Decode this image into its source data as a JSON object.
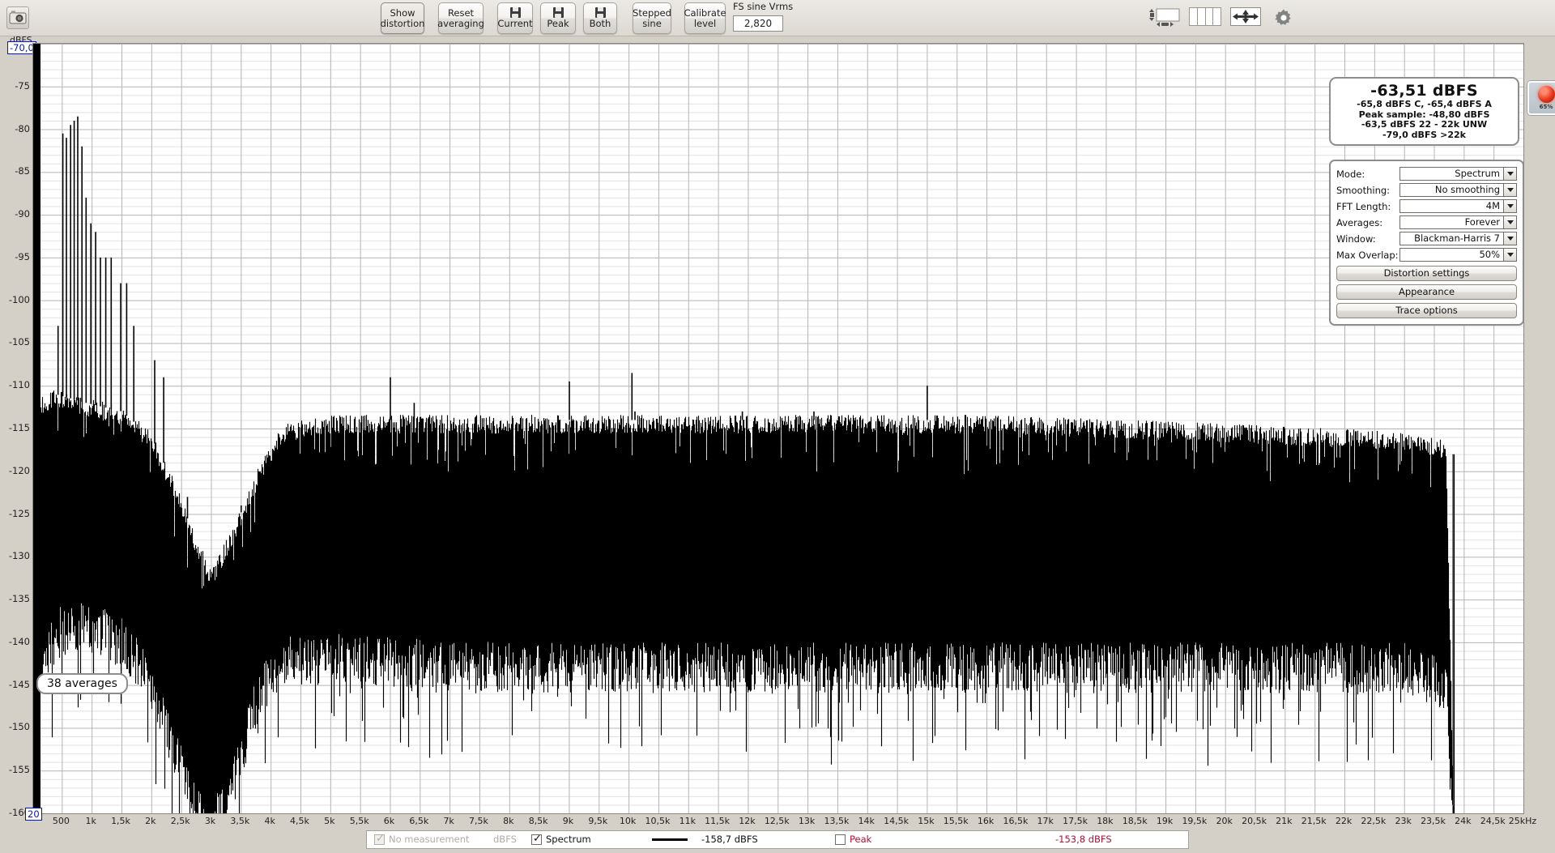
{
  "toolbar": {
    "camera_icon": "camera-icon",
    "buttons": [
      {
        "name": "show-distortion",
        "lines": [
          "Show",
          "distortion"
        ],
        "icon": null,
        "active": true,
        "x": 470,
        "w": 54
      },
      {
        "name": "reset-averaging",
        "lines": [
          "Reset",
          "averaging"
        ],
        "icon": null,
        "active": false,
        "x": 541,
        "w": 56
      },
      {
        "name": "save-current",
        "lines": [
          "Current"
        ],
        "icon": "floppy-icon",
        "active": false,
        "x": 614,
        "w": 44
      },
      {
        "name": "save-peak",
        "lines": [
          "Peak"
        ],
        "icon": "floppy-icon",
        "active": false,
        "x": 667,
        "w": 44
      },
      {
        "name": "save-both",
        "lines": [
          "Both"
        ],
        "icon": "floppy-icon",
        "active": false,
        "x": 720,
        "w": 42
      },
      {
        "name": "stepped-sine",
        "lines": [
          "Stepped",
          "sine"
        ],
        "icon": null,
        "active": false,
        "x": 781,
        "w": 48
      },
      {
        "name": "calibrate-level",
        "lines": [
          "Calibrate",
          "level"
        ],
        "icon": null,
        "active": false,
        "x": 845,
        "w": 51
      }
    ],
    "fs_sine": {
      "label": "FS sine Vrms",
      "value": "2,820"
    },
    "right_icons": [
      "scroll-box-icon",
      "columns-icon",
      "pan-arrows-icon",
      "gear-icon"
    ]
  },
  "chart_data": {
    "type": "line",
    "title": "",
    "xlabel": "",
    "ylabel": "dBFS",
    "xlim": [
      20,
      25000
    ],
    "ylim": [
      -160,
      -70
    ],
    "y_unit": "dBFS",
    "y_top_value": "-70,0",
    "x_start_value": "20",
    "x_end_label": "25kHz",
    "yticks": [
      -75,
      -80,
      -85,
      -90,
      -95,
      -100,
      -105,
      -110,
      -115,
      -120,
      -125,
      -130,
      -135,
      -140,
      -145,
      -150,
      -155,
      -160
    ],
    "ytick_labels": [
      "-75",
      "-80",
      "-85",
      "-90",
      "-95",
      "-100",
      "-105",
      "-110",
      "-115",
      "-120",
      "-125",
      "-130",
      "-135",
      "-140",
      "-145",
      "-150",
      "-155",
      "-160"
    ],
    "xticks": [
      500,
      1000,
      1500,
      2000,
      2500,
      3000,
      3500,
      4000,
      4500,
      5000,
      5500,
      6000,
      6500,
      7000,
      7500,
      8000,
      8500,
      9000,
      9500,
      10000,
      10500,
      11000,
      11500,
      12000,
      12500,
      13000,
      13500,
      14000,
      14500,
      15000,
      15500,
      16000,
      16500,
      17000,
      17500,
      18000,
      18500,
      19000,
      19500,
      20000,
      20500,
      21000,
      21500,
      22000,
      22500,
      23000,
      23500,
      24000,
      24500,
      25000
    ],
    "xtick_labels": [
      "500",
      "1k",
      "1,5k",
      "2k",
      "2,5k",
      "3k",
      "3,5k",
      "4k",
      "4,5k",
      "5k",
      "5,5k",
      "6k",
      "6,5k",
      "7k",
      "7,5k",
      "8k",
      "8,5k",
      "9k",
      "9,5k",
      "10k",
      "10,5k",
      "11k",
      "11,5k",
      "12k",
      "12,5k",
      "13k",
      "13,5k",
      "14k",
      "14,5k",
      "15k",
      "15,5k",
      "16k",
      "16,5k",
      "17k",
      "17,5k",
      "18k",
      "18,5k",
      "19k",
      "19,5k",
      "20k",
      "20,5k",
      "21k",
      "21,5k",
      "22k",
      "22,5k",
      "23k",
      "23,5k",
      "24k",
      "24,5k",
      "25kHz"
    ],
    "grid": true,
    "legend": "none",
    "trace_color": "#000000",
    "annotation": "38 averages",
    "series": [
      {
        "name": "Spectrum",
        "description": "FFT noise floor of an audio ADC measurement with low-frequency harmonic spikes and a brickwall anti-alias rolloff near 23,8 kHz",
        "noise_floor_envelope": [
          {
            "hz": 20,
            "top_db": -118,
            "bottom_db": -160
          },
          {
            "hz": 120,
            "top_db": -113,
            "bottom_db": -140
          },
          {
            "hz": 400,
            "top_db": -112,
            "bottom_db": -136
          },
          {
            "hz": 900,
            "top_db": -113,
            "bottom_db": -135
          },
          {
            "hz": 1500,
            "top_db": -114,
            "bottom_db": -137
          },
          {
            "hz": 2000,
            "top_db": -117,
            "bottom_db": -142
          },
          {
            "hz": 2400,
            "top_db": -123,
            "bottom_db": -150
          },
          {
            "hz": 2800,
            "top_db": -130,
            "bottom_db": -157
          },
          {
            "hz": 3000,
            "top_db": -133,
            "bottom_db": -159
          },
          {
            "hz": 3300,
            "top_db": -129,
            "bottom_db": -155
          },
          {
            "hz": 3800,
            "top_db": -121,
            "bottom_db": -143
          },
          {
            "hz": 4200,
            "top_db": -116,
            "bottom_db": -139
          },
          {
            "hz": 5000,
            "top_db": -115,
            "bottom_db": -139
          },
          {
            "hz": 8000,
            "top_db": -115,
            "bottom_db": -140
          },
          {
            "hz": 12000,
            "top_db": -115,
            "bottom_db": -140
          },
          {
            "hz": 16000,
            "top_db": -115,
            "bottom_db": -140
          },
          {
            "hz": 20000,
            "top_db": -116,
            "bottom_db": -140
          },
          {
            "hz": 23000,
            "top_db": -117,
            "bottom_db": -140
          },
          {
            "hz": 23700,
            "top_db": -118,
            "bottom_db": -142
          },
          {
            "hz": 23820,
            "top_db": -160,
            "bottom_db": -160
          }
        ],
        "harmonic_spikes": [
          {
            "hz": 110,
            "db": -94.5
          },
          {
            "hz": 350,
            "db": -132
          },
          {
            "hz": 430,
            "db": -103
          },
          {
            "hz": 510,
            "db": -80.5
          },
          {
            "hz": 570,
            "db": -81
          },
          {
            "hz": 640,
            "db": -79.5
          },
          {
            "hz": 700,
            "db": -79
          },
          {
            "hz": 760,
            "db": -78.5
          },
          {
            "hz": 830,
            "db": -82
          },
          {
            "hz": 900,
            "db": -88
          },
          {
            "hz": 980,
            "db": -91
          },
          {
            "hz": 1060,
            "db": -92
          },
          {
            "hz": 1140,
            "db": -95
          },
          {
            "hz": 1230,
            "db": -95
          },
          {
            "hz": 1320,
            "db": -95
          },
          {
            "hz": 1480,
            "db": -98
          },
          {
            "hz": 1580,
            "db": -98
          },
          {
            "hz": 1700,
            "db": -103
          },
          {
            "hz": 2050,
            "db": -107
          },
          {
            "hz": 2200,
            "db": -109
          },
          {
            "hz": 2600,
            "db": -123
          },
          {
            "hz": 3500,
            "db": -124
          },
          {
            "hz": 6000,
            "db": -109
          },
          {
            "hz": 6400,
            "db": -112
          },
          {
            "hz": 9000,
            "db": -109.5
          },
          {
            "hz": 10050,
            "db": -108.5
          },
          {
            "hz": 10100,
            "db": -113
          },
          {
            "hz": 15000,
            "db": -110
          },
          {
            "hz": 11900,
            "db": -113
          },
          {
            "hz": 13100,
            "db": -113
          }
        ]
      }
    ]
  },
  "readout": {
    "main": "-63,51 dBFS",
    "lines": [
      "-65,8 dBFS C, -65,4 dBFS A",
      "Peak sample: -48,80 dBFS",
      "-63,5 dBFS 22 - 22k UNW",
      "-79,0 dBFS >22k"
    ]
  },
  "led": {
    "percent": "65%",
    "color": "#e8381d"
  },
  "settings": {
    "rows": [
      {
        "name": "mode",
        "label": "Mode:",
        "value": "Spectrum"
      },
      {
        "name": "smoothing",
        "label": "Smoothing:",
        "value": "No  smoothing"
      },
      {
        "name": "fft-length",
        "label": "FFT Length:",
        "value": "4M"
      },
      {
        "name": "averages",
        "label": "Averages:",
        "value": "Forever"
      },
      {
        "name": "window",
        "label": "Window:",
        "value": "Blackman-Harris 7"
      },
      {
        "name": "max-overlap",
        "label": "Max Overlap:",
        "value": "50%"
      }
    ],
    "buttons": [
      {
        "name": "distortion-settings",
        "label": "Distortion settings"
      },
      {
        "name": "appearance",
        "label": "Appearance"
      },
      {
        "name": "trace-options",
        "label": "Trace options"
      }
    ]
  },
  "statusbar": {
    "no_measurement": {
      "label": "No measurement",
      "checked": true,
      "enabled": false
    },
    "unit": "dBFS",
    "spectrum": {
      "label": "Spectrum",
      "checked": true
    },
    "spectrum_value": "-158,7 dBFS",
    "peak": {
      "label": "Peak",
      "checked": false
    },
    "peak_value": "-153,8 dBFS",
    "peak_color": "#b81030"
  }
}
